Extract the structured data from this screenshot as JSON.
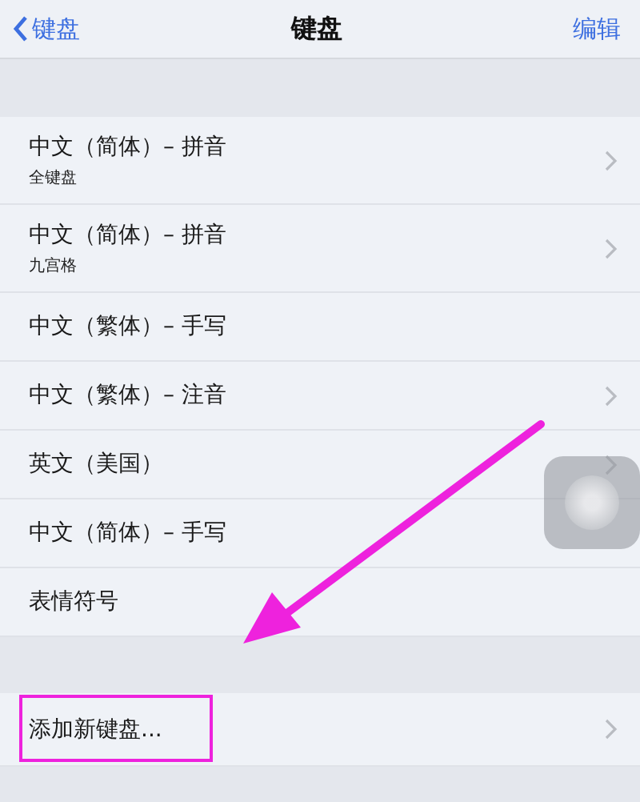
{
  "nav": {
    "back": "键盘",
    "title": "键盘",
    "action": "编辑"
  },
  "keyboards": [
    {
      "title": "中文（简体）– 拼音",
      "subtitle": "全键盘",
      "chevron": true
    },
    {
      "title": "中文（简体）– 拼音",
      "subtitle": "九宫格",
      "chevron": true
    },
    {
      "title": "中文（繁体）– 手写",
      "chevron": false
    },
    {
      "title": "中文（繁体）– 注音",
      "chevron": true
    },
    {
      "title": "英文（美国）",
      "chevron": true
    },
    {
      "title": "中文（简体）– 手写",
      "chevron": false
    },
    {
      "title": "表情符号",
      "chevron": false
    }
  ],
  "add_row": {
    "title": "添加新键盘...",
    "chevron": true,
    "highlighted": true
  }
}
